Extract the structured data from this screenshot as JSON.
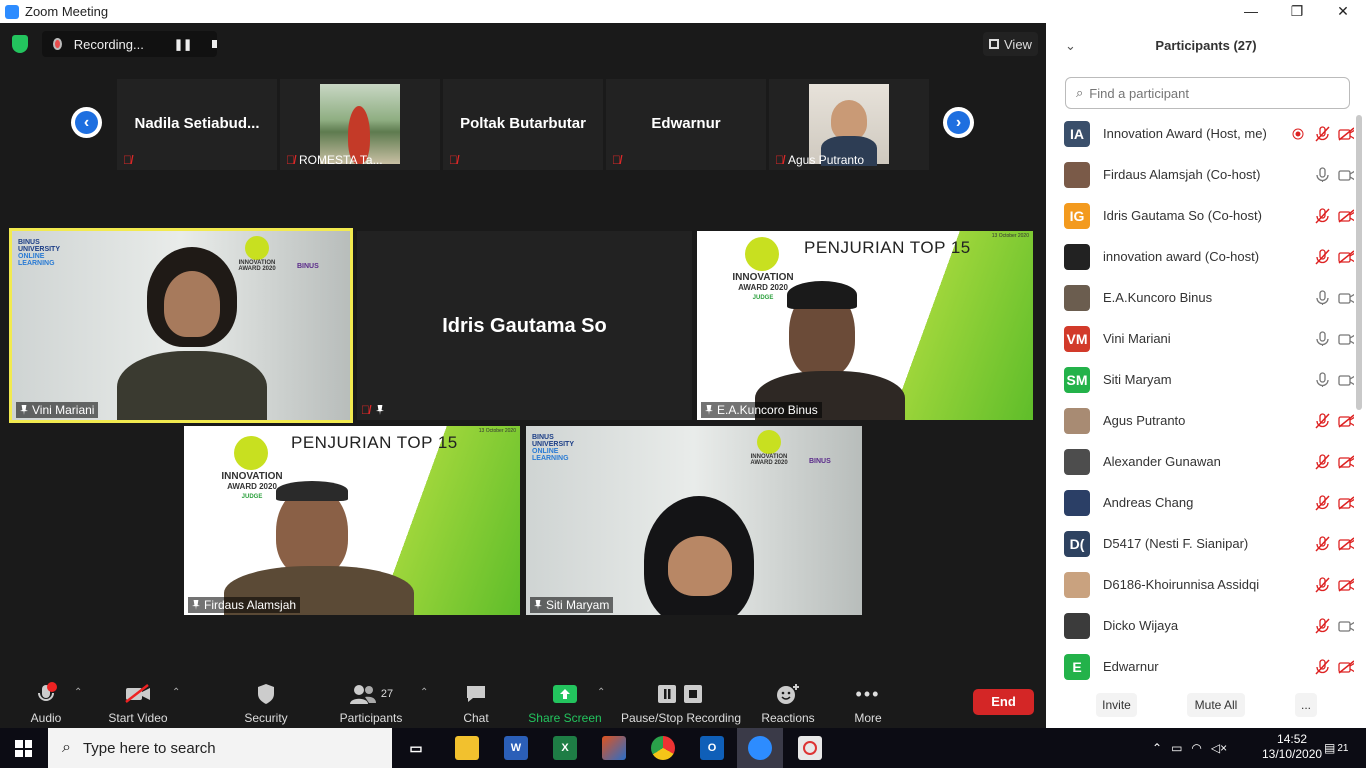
{
  "window": {
    "title": "Zoom Meeting",
    "btn_min": "—",
    "btn_max": "❐",
    "btn_close": "✕"
  },
  "top_bar": {
    "recording_label": "Recording...",
    "pause_glyph": "❚❚",
    "view_label": "View"
  },
  "strip": {
    "prev_glyph": "‹",
    "next_glyph": "›",
    "thumbs": [
      {
        "name": "Nadila  Setiabud...",
        "type": "name"
      },
      {
        "name": "ROMESTA Ta...",
        "type": "video"
      },
      {
        "name": "Poltak Butarbutar",
        "type": "name"
      },
      {
        "name": "Edwarnur",
        "type": "name"
      },
      {
        "name": "Agus Putranto",
        "type": "video"
      }
    ]
  },
  "tiles": {
    "vini": {
      "name": "Vini Mariani",
      "logo_binus": "BINUS",
      "logo_sub1": "UNIVERSITY",
      "logo_sub2": "ONLINE",
      "logo_sub3": "LEARNING",
      "ia_line1": "INNOVATION",
      "ia_line2": "AWARD 2020",
      "binus_right": "BINUS"
    },
    "idris": {
      "name": "Idris Gautama So"
    },
    "kuncoro": {
      "name": "E.A.Kuncoro Binus",
      "slide_title": "PENJURIAN TOP 15",
      "date": "13 October 2020",
      "ia_line1": "INNOVATION",
      "ia_line2": "AWARD 2020",
      "ia_line3": "JUDGE"
    },
    "firdaus": {
      "name": "Firdaus Alamsjah",
      "slide_title": "PENJURIAN TOP 15",
      "date": "13 October 2020",
      "ia_line1": "INNOVATION",
      "ia_line2": "AWARD 2020",
      "ia_line3": "JUDGE"
    },
    "siti": {
      "name": "Siti Maryam",
      "logo_binus": "BINUS",
      "logo_sub1": "UNIVERSITY",
      "logo_sub2": "ONLINE",
      "logo_sub3": "LEARNING",
      "ia_line1": "INNOVATION",
      "ia_line2": "AWARD 2020",
      "binus_right": "BINUS"
    }
  },
  "toolbar": {
    "audio": "Audio",
    "start_video": "Start Video",
    "security": "Security",
    "participants": "Participants",
    "participants_count": "27",
    "chat": "Chat",
    "share_screen": "Share Screen",
    "pause_stop": "Pause/Stop Recording",
    "reactions": "Reactions",
    "more": "More",
    "end": "End"
  },
  "panel": {
    "title": "Participants (27)",
    "search_placeholder": "Find a participant",
    "participants": [
      {
        "initials": "IA",
        "name": "Innovation Award (Host, me)",
        "color": "#3a4f6b",
        "mic": "muted",
        "video": "off",
        "rec": true
      },
      {
        "initials": "",
        "name": "Firdaus Alamsjah (Co-host)",
        "color": "#7a5a48",
        "mic": "on",
        "video": "on"
      },
      {
        "initials": "IG",
        "name": "Idris Gautama So (Co-host)",
        "color": "#f39a1e",
        "mic": "muted",
        "video": "off"
      },
      {
        "initials": "",
        "name": "innovation award (Co-host)",
        "color": "#222222",
        "mic": "muted",
        "video": "off"
      },
      {
        "initials": "",
        "name": "E.A.Kuncoro Binus",
        "color": "#6b5d4f",
        "mic": "on",
        "video": "on"
      },
      {
        "initials": "VM",
        "name": "Vini Mariani",
        "color": "#d23a2a",
        "mic": "on",
        "video": "on"
      },
      {
        "initials": "SM",
        "name": "Siti Maryam",
        "color": "#23b24a",
        "mic": "on",
        "video": "on"
      },
      {
        "initials": "",
        "name": "Agus Putranto",
        "color": "#a88b73",
        "mic": "muted",
        "video": "off"
      },
      {
        "initials": "",
        "name": "Alexander Gunawan",
        "color": "#4d4d4d",
        "mic": "muted",
        "video": "off"
      },
      {
        "initials": "",
        "name": "Andreas Chang",
        "color": "#2b3f66",
        "mic": "muted",
        "video": "off"
      },
      {
        "initials": "D(",
        "name": "D5417 (Nesti F. Sianipar)",
        "color": "#2e4260",
        "mic": "muted",
        "video": "off"
      },
      {
        "initials": "",
        "name": "D6186-Khoirunnisa Assidqi",
        "color": "#c9a27f",
        "mic": "muted",
        "video": "off"
      },
      {
        "initials": "",
        "name": "Dicko Wijaya",
        "color": "#3b3b3b",
        "mic": "muted",
        "video": "on"
      },
      {
        "initials": "E",
        "name": "Edwarnur",
        "color": "#23b24a",
        "mic": "muted",
        "video": "off"
      }
    ],
    "invite": "Invite",
    "mute_all": "Mute All",
    "more": "..."
  },
  "taskbar": {
    "search_placeholder": "Type here to search",
    "time": "14:52",
    "date": "13/10/2020",
    "notif_count": "21",
    "apps": [
      "task-view",
      "file-explorer",
      "word",
      "excel",
      "matlab",
      "chrome",
      "outlook",
      "zoom",
      "app-extra"
    ]
  }
}
